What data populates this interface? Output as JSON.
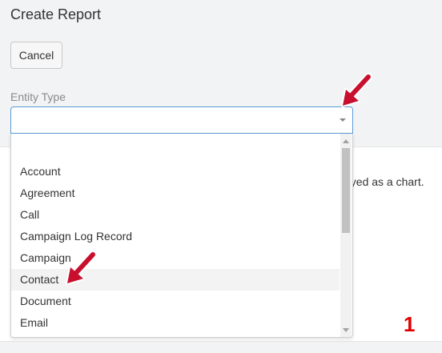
{
  "page": {
    "title": "Create Report"
  },
  "actions": {
    "cancel_label": "Cancel"
  },
  "form": {
    "entity_type_label": "Entity Type",
    "entity_type_value": ""
  },
  "background": {
    "panel_text": "ayed as a chart."
  },
  "dropdown": {
    "items": [
      "",
      "Account",
      "Agreement",
      "Call",
      "Campaign Log Record",
      "Campaign",
      "Contact",
      "Document",
      "Email"
    ],
    "hovered_item": "Contact"
  },
  "annotation": {
    "step_number": "1",
    "color": "#e00000"
  },
  "colors": {
    "focus_border": "#5b9bd5",
    "arrow": "#c8102e"
  }
}
